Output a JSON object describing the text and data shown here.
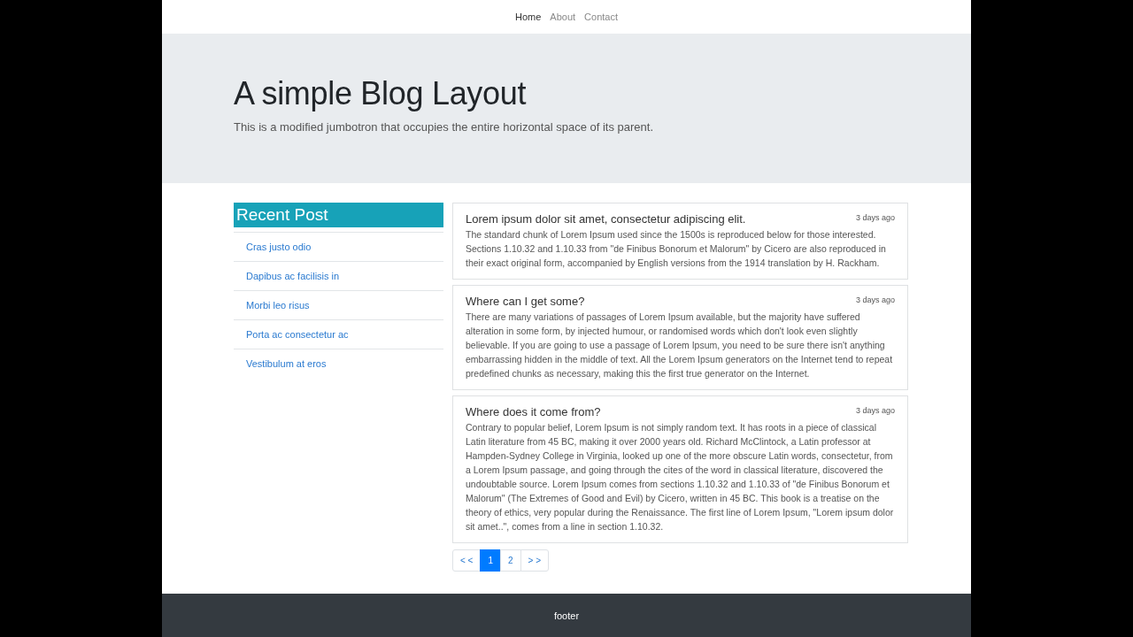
{
  "nav": {
    "links": [
      {
        "label": "Home",
        "selected": true
      },
      {
        "label": "About",
        "selected": false
      },
      {
        "label": "Contact",
        "selected": false
      }
    ]
  },
  "hero": {
    "title": "A simple Blog Layout",
    "subtitle": "This is a modified jumbotron that occupies the entire horizontal space of its parent."
  },
  "sidebar": {
    "title": "Recent Post",
    "items": [
      "Cras justo odio",
      "Dapibus ac facilisis in",
      "Morbi leo risus",
      "Porta ac consectetur ac",
      "Vestibulum at eros"
    ]
  },
  "posts": [
    {
      "title": "Lorem ipsum dolor sit amet, consectetur adipiscing elit.",
      "time": "3 days ago",
      "body": "The standard chunk of Lorem Ipsum used since the 1500s is reproduced below for those interested. Sections 1.10.32 and 1.10.33 from \"de Finibus Bonorum et Malorum\" by Cicero are also reproduced in their exact original form, accompanied by English versions from the 1914 translation by H. Rackham."
    },
    {
      "title": "Where can I get some?",
      "time": "3 days ago",
      "body": "There are many variations of passages of Lorem Ipsum available, but the majority have suffered alteration in some form, by injected humour, or randomised words which don't look even slightly believable. If you are going to use a passage of Lorem Ipsum, you need to be sure there isn't anything embarrassing hidden in the middle of text. All the Lorem Ipsum generators on the Internet tend to repeat predefined chunks as necessary, making this the first true generator on the Internet."
    },
    {
      "title": "Where does it come from?",
      "time": "3 days ago",
      "body": "Contrary to popular belief, Lorem Ipsum is not simply random text. It has roots in a piece of classical Latin literature from 45 BC, making it over 2000 years old. Richard McClintock, a Latin professor at Hampden-Sydney College in Virginia, looked up one of the more obscure Latin words, consectetur, from a Lorem Ipsum passage, and going through the cites of the word in classical literature, discovered the undoubtable source. Lorem Ipsum comes from sections 1.10.32 and 1.10.33 of \"de Finibus Bonorum et Malorum\" (The Extremes of Good and Evil) by Cicero, written in 45 BC. This book is a treatise on the theory of ethics, very popular during the Renaissance. The first line of Lorem Ipsum, \"Lorem ipsum dolor sit amet..\", comes from a line in section 1.10.32."
    }
  ],
  "pagination": {
    "pages": [
      {
        "label": "< <",
        "selected": false
      },
      {
        "label": "1",
        "selected": true
      },
      {
        "label": "2",
        "selected": false
      },
      {
        "label": "> >",
        "selected": false
      }
    ]
  },
  "footer": {
    "text": "footer"
  }
}
